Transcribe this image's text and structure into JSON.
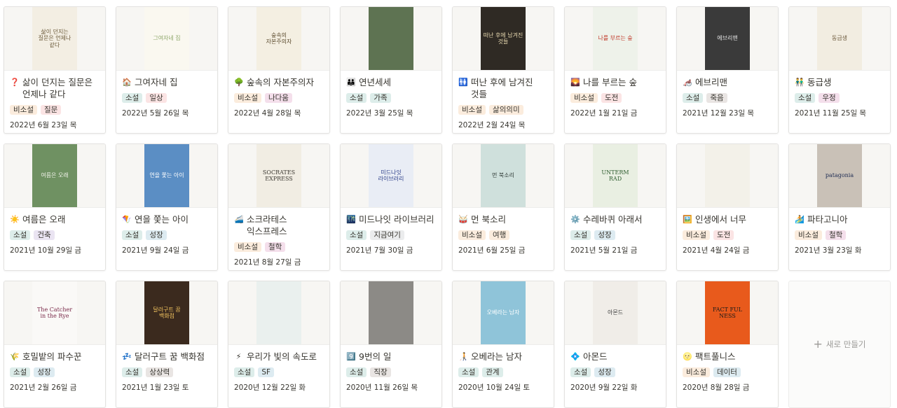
{
  "cards": [
    {
      "icon": "❓",
      "iconName": "question-icon",
      "title": "삶이 던지는 질문은 언제나 같다",
      "tags": [
        {
          "label": "비소설",
          "c": "t-orange"
        },
        {
          "label": "질문",
          "c": "t-red"
        }
      ],
      "date": "2022년 6월 23일 목",
      "cover": {
        "bg": "#f3eee3",
        "fg": "#6b5a3a",
        "text": "삶이 던지는 질문은 언제나 같다"
      }
    },
    {
      "icon": "🏠",
      "iconName": "house-icon",
      "title": "그여자네 집",
      "tags": [
        {
          "label": "소설",
          "c": "t-green"
        },
        {
          "label": "일상",
          "c": "t-red"
        }
      ],
      "date": "2022년 5월 26일 목",
      "cover": {
        "bg": "#faf8f0",
        "fg": "#8fa86b",
        "text": "그여자네 집"
      }
    },
    {
      "icon": "🌳",
      "iconName": "tree-icon",
      "title": "숲속의 자본주의자",
      "tags": [
        {
          "label": "비소설",
          "c": "t-orange"
        },
        {
          "label": "나다움",
          "c": "t-pink"
        }
      ],
      "date": "2022년 4월 28일 목",
      "cover": {
        "bg": "#f4efe2",
        "fg": "#5b4b2e",
        "text": "숲속의 자본주의자"
      }
    },
    {
      "icon": "👪",
      "iconName": "family-icon",
      "title": "연년세세",
      "tags": [
        {
          "label": "소설",
          "c": "t-green"
        },
        {
          "label": "가족",
          "c": "t-green"
        }
      ],
      "date": "2022년 3월 25일 목",
      "cover": {
        "bg": "#5e7352",
        "fg": "#dfe6d4",
        "text": ""
      }
    },
    {
      "icon": "🚻",
      "iconName": "restroom-icon",
      "title": "떠난 후에 남겨진 것들",
      "tags": [
        {
          "label": "비소설",
          "c": "t-orange"
        },
        {
          "label": "삶의의미",
          "c": "t-orange"
        }
      ],
      "date": "2022년 2월 24일 목",
      "cover": {
        "bg": "#2f2a24",
        "fg": "#e8d9b0",
        "text": "떠난 후에 남겨진 것들"
      }
    },
    {
      "icon": "🌄",
      "iconName": "sunrise-icon",
      "title": "나를 부르는 숲",
      "tags": [
        {
          "label": "비소설",
          "c": "t-orange"
        },
        {
          "label": "도전",
          "c": "t-red"
        }
      ],
      "date": "2022년 1월 21일 금",
      "cover": {
        "bg": "#eef2ea",
        "fg": "#c0392b",
        "text": "나를 부르는 숲"
      }
    },
    {
      "icon": "🦽",
      "iconName": "wheelchair-icon",
      "title": "에브리맨",
      "tags": [
        {
          "label": "소설",
          "c": "t-green"
        },
        {
          "label": "죽음",
          "c": "t-brown"
        }
      ],
      "date": "2021년 12월 23일 목",
      "cover": {
        "bg": "#3a3a3a",
        "fg": "#e6e6e6",
        "text": "에브리맨"
      }
    },
    {
      "icon": "👬",
      "iconName": "two-people-icon",
      "title": "동급생",
      "tags": [
        {
          "label": "소설",
          "c": "t-green"
        },
        {
          "label": "우정",
          "c": "t-pink"
        }
      ],
      "date": "2021년 11월 25일 목",
      "cover": {
        "bg": "#f2ede1",
        "fg": "#6d5a3d",
        "text": "동급생"
      }
    },
    {
      "icon": "☀️",
      "iconName": "sun-icon",
      "title": "여름은 오래",
      "tags": [
        {
          "label": "소설",
          "c": "t-green"
        },
        {
          "label": "건축",
          "c": "t-purple"
        }
      ],
      "date": "2021년 10월 29일 금",
      "cover": {
        "bg": "#6f9162",
        "fg": "#f2f2ea",
        "text": "여름은 오래"
      }
    },
    {
      "icon": "🪁",
      "iconName": "kite-icon",
      "title": "연을 쫓는 아이",
      "tags": [
        {
          "label": "소설",
          "c": "t-green"
        },
        {
          "label": "성장",
          "c": "t-blue"
        }
      ],
      "date": "2021년 9월 24일 금",
      "cover": {
        "bg": "#5b8ec4",
        "fg": "#ffffff",
        "text": "연을 쫓는 아이"
      }
    },
    {
      "icon": "🚄",
      "iconName": "train-icon",
      "title": "소크라테스 익스프레스",
      "tags": [
        {
          "label": "비소설",
          "c": "t-orange"
        },
        {
          "label": "철학",
          "c": "t-pink"
        }
      ],
      "date": "2021년 8월 27일 금",
      "cover": {
        "bg": "#f1ede3",
        "fg": "#3d3a33",
        "text": "SOCRATES EXPRESS"
      }
    },
    {
      "icon": "🌃",
      "iconName": "night-city-icon",
      "title": "미드나잇 라이브러리",
      "tags": [
        {
          "label": "소설",
          "c": "t-green"
        },
        {
          "label": "지금여기",
          "c": "t-gray"
        }
      ],
      "date": "2021년 7월 30일 금",
      "cover": {
        "bg": "#e9edf5",
        "fg": "#2d3f8a",
        "text": "미드나잇 라이브러리"
      }
    },
    {
      "icon": "🥁",
      "iconName": "drum-icon",
      "title": "먼 북소리",
      "tags": [
        {
          "label": "비소설",
          "c": "t-orange"
        },
        {
          "label": "여행",
          "c": "t-orange"
        }
      ],
      "date": "2021년 6월 25일 금",
      "cover": {
        "bg": "#cfe0dc",
        "fg": "#2f3a36",
        "text": "먼 북소리"
      }
    },
    {
      "icon": "⚙️",
      "iconName": "gear-icon",
      "title": "수레바퀴 아래서",
      "tags": [
        {
          "label": "소설",
          "c": "t-green"
        },
        {
          "label": "성장",
          "c": "t-blue"
        }
      ],
      "date": "2021년 5월 21일 금",
      "cover": {
        "bg": "#e9efe2",
        "fg": "#2e5d2f",
        "text": "UNTERM RAD"
      }
    },
    {
      "icon": "🖼️",
      "iconName": "picture-icon",
      "title": "인생에서 너무",
      "tags": [
        {
          "label": "비소설",
          "c": "t-orange"
        },
        {
          "label": "도전",
          "c": "t-red"
        }
      ],
      "date": "2021년 4월 24일 금",
      "cover": {
        "bg": "#f3f1e9",
        "fg": "#4a5d3b",
        "text": ""
      }
    },
    {
      "icon": "🏄",
      "iconName": "surfer-icon",
      "title": "파타고니아",
      "tags": [
        {
          "label": "비소설",
          "c": "t-orange"
        },
        {
          "label": "철학",
          "c": "t-pink"
        }
      ],
      "date": "2021년 3월 23일 화",
      "cover": {
        "bg": "#c9c1b7",
        "fg": "#1e2c53",
        "text": "patagonia"
      }
    },
    {
      "icon": "🌾",
      "iconName": "rice-plant-icon",
      "title": "호밀밭의 파수꾼",
      "tags": [
        {
          "label": "소설",
          "c": "t-green"
        },
        {
          "label": "성장",
          "c": "t-blue"
        }
      ],
      "date": "2021년 2월 26일 금",
      "cover": {
        "bg": "#faf9f7",
        "fg": "#7a2a4a",
        "text": "The Catcher in the Rye"
      }
    },
    {
      "icon": "💤",
      "iconName": "sleep-icon",
      "title": "달러구트 꿈 백화점",
      "tags": [
        {
          "label": "소설",
          "c": "t-green"
        },
        {
          "label": "상상력",
          "c": "t-brown"
        }
      ],
      "date": "2021년 1월 23일 토",
      "cover": {
        "bg": "#3b2a1e",
        "fg": "#f0c25e",
        "text": "달러구트 꿈 백화점"
      }
    },
    {
      "icon": "⚡",
      "iconName": "lightning-icon",
      "title": "우리가 빛의 속도로",
      "tags": [
        {
          "label": "소설",
          "c": "t-green"
        },
        {
          "label": "SF",
          "c": "t-blue"
        }
      ],
      "date": "2020년 12월 22일 화",
      "cover": {
        "bg": "#eaf0ee",
        "fg": "#6a7b8a",
        "text": ""
      }
    },
    {
      "icon": "9️⃣",
      "iconName": "number-nine-icon",
      "title": "9번의 일",
      "tags": [
        {
          "label": "소설",
          "c": "t-green"
        },
        {
          "label": "직장",
          "c": "t-brown"
        }
      ],
      "date": "2020년 11월 26일 목",
      "cover": {
        "bg": "#8c8a86",
        "fg": "#ffffff",
        "text": ""
      }
    },
    {
      "icon": "🧑‍🦯",
      "iconName": "person-cane-icon",
      "title": "오베라는 남자",
      "tags": [
        {
          "label": "소설",
          "c": "t-green"
        },
        {
          "label": "관계",
          "c": "t-green"
        }
      ],
      "date": "2020년 10월 24일 토",
      "cover": {
        "bg": "#8fc4d9",
        "fg": "#ffffff",
        "text": "오베라는 남자"
      }
    },
    {
      "icon": "💠",
      "iconName": "diamond-icon",
      "title": "아몬드",
      "tags": [
        {
          "label": "소설",
          "c": "t-green"
        },
        {
          "label": "성장",
          "c": "t-blue"
        }
      ],
      "date": "2020년 9월 22일 화",
      "cover": {
        "bg": "#f0ede8",
        "fg": "#3a3a3a",
        "text": "아몬드"
      }
    },
    {
      "icon": "🌝",
      "iconName": "moon-face-icon",
      "title": "팩트풀니스",
      "tags": [
        {
          "label": "비소설",
          "c": "t-orange"
        },
        {
          "label": "데이터",
          "c": "t-blue"
        }
      ],
      "date": "2020년 8월 28일 금",
      "cover": {
        "bg": "#e85a1c",
        "fg": "#1a1a1a",
        "text": "FACT FUL NESS"
      }
    }
  ],
  "newCard": {
    "label": "새로 만들기"
  }
}
